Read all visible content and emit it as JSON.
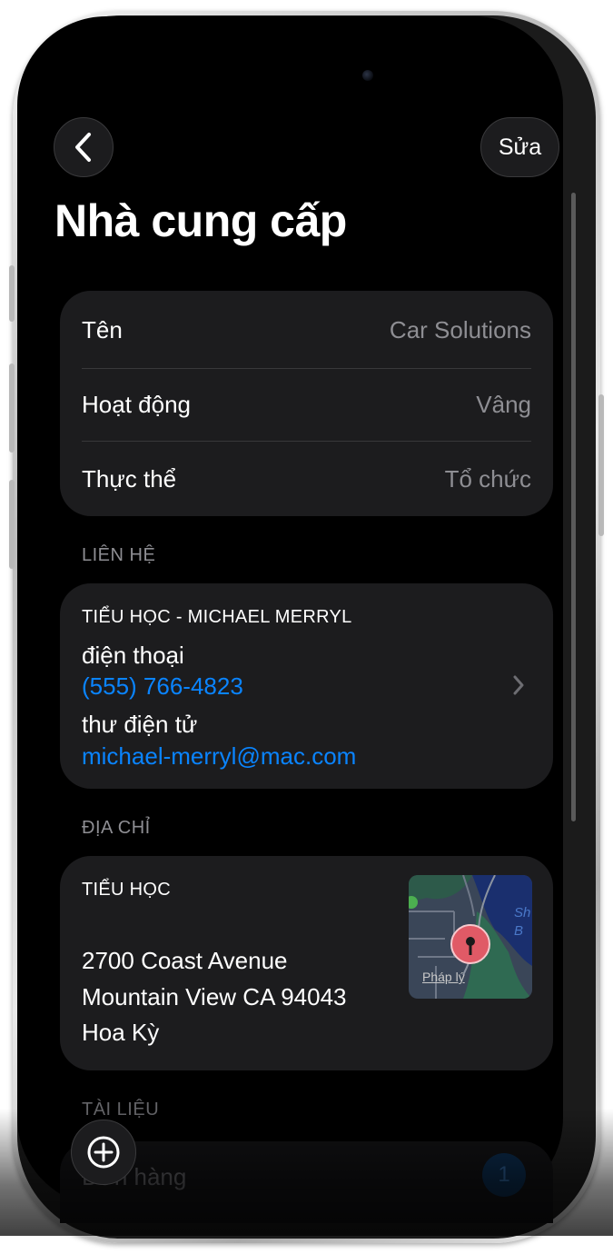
{
  "nav": {
    "edit_label": "Sửa",
    "title": "Nhà cung cấp"
  },
  "info": {
    "rows": [
      {
        "label": "Tên",
        "value": "Car Solutions"
      },
      {
        "label": "Hoạt động",
        "value": "Vâng"
      },
      {
        "label": "Thực thể",
        "value": "Tổ chức"
      }
    ]
  },
  "contact": {
    "section": "LIÊN HỆ",
    "heading": "TIỂU HỌC - MICHAEL MERRYL",
    "phone_label": "điện thoại",
    "phone": "(555) 766-4823",
    "email_label": "thư điện tử",
    "email": "michael-merryl@mac.com"
  },
  "address": {
    "section": "ĐỊA CHỈ",
    "heading": "TIỂU HỌC",
    "line1": "2700 Coast Avenue",
    "line2": "Mountain View CA 94043",
    "line3": "Hoa Kỳ",
    "map_legal": "Pháp lý",
    "map_icon": "map-pin-icon"
  },
  "documents": {
    "section": "TÀI LIỆU",
    "orders_label": "Đơn hàng",
    "orders_count": "1"
  },
  "colors": {
    "accent": "#0a84ff",
    "card": "#1c1c1e",
    "pin": "#e05a66"
  }
}
